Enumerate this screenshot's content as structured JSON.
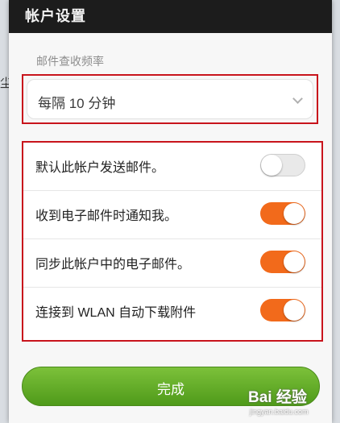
{
  "dialog": {
    "title": "帐户设置"
  },
  "frequency": {
    "section_label": "邮件查收频率",
    "selected_value": "每隔 10 分钟"
  },
  "toggles": [
    {
      "label": "默认此帐户发送邮件。",
      "state": "off"
    },
    {
      "label": "收到电子邮件时通知我。",
      "state": "on"
    },
    {
      "label": "同步此帐户中的电子邮件。",
      "state": "on"
    },
    {
      "label": "连接到 WLAN 自动下载附件",
      "state": "on"
    }
  ],
  "footer": {
    "done_label": "完成"
  },
  "watermark": {
    "text": "Bai 经验",
    "sub": "jingyan.baidu.com"
  },
  "colors": {
    "accent_on": "#f26a1b",
    "highlight_border": "#c8141c",
    "done_button": "#5fa825"
  }
}
